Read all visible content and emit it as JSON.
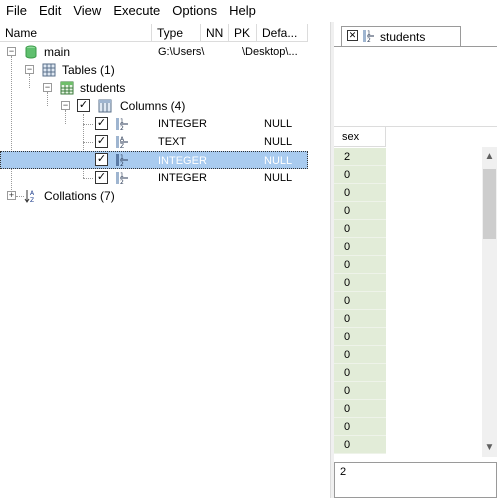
{
  "menu": [
    "File",
    "Edit",
    "View",
    "Execute",
    "Options",
    "Help"
  ],
  "tree": {
    "headers": [
      "Name",
      "Type",
      "NN",
      "PK",
      "Defa..."
    ],
    "main": {
      "label": "main",
      "path_a": "G:\\Users\\",
      "path_b": "\\Desktop\\..."
    },
    "tables": "Tables (1)",
    "students": "students",
    "columns": "Columns (4)",
    "column_rows": [
      {
        "type": "INTEGER",
        "default": "NULL",
        "checked": "✓"
      },
      {
        "type": "TEXT",
        "default": "NULL",
        "checked": "✓"
      },
      {
        "type": "INTEGER",
        "default": "NULL",
        "checked": "✓"
      },
      {
        "type": "INTEGER",
        "default": "NULL",
        "checked": "✓"
      }
    ],
    "collations": "Collations (7)",
    "expander_minus": "−",
    "expander_plus": "+"
  },
  "right": {
    "tab_label": "students",
    "tab_close": "✕",
    "grid_header": "sex",
    "values": [
      "2",
      "0",
      "0",
      "0",
      "0",
      "0",
      "0",
      "0",
      "0",
      "0",
      "0",
      "0",
      "0",
      "0",
      "0",
      "0",
      "0"
    ],
    "edit_value": "2",
    "scroll_up": "▲",
    "scroll_down": "▼"
  },
  "colors": {
    "selection": "#a9cbef",
    "grid_cell": "#e2ecd8",
    "db_icon": "#5fbf6e"
  },
  "icons": [
    "database-icon",
    "table-grid-icon",
    "table-icon",
    "columns-icon",
    "number-type-icon",
    "text-type-icon",
    "sort-az-icon"
  ]
}
